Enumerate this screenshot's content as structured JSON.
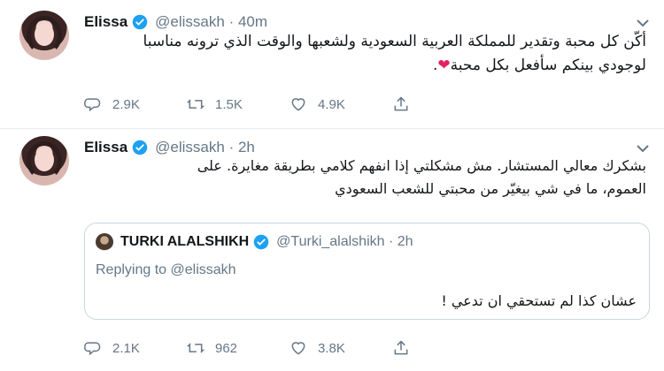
{
  "tweets": [
    {
      "name": "Elissa",
      "handle": "@elissakh",
      "time": "40m",
      "text_line1": "أكّن كل محبة وتقدير للمملكة العربية السعودية ولشعبها والوقت الذي ترونه مناسبا",
      "text_line2": "لوجودي بينكم سأفعل بكل محبة",
      "emoji": "❤",
      "replies": "2.9K",
      "retweets": "1.5K",
      "likes": "4.9K"
    },
    {
      "name": "Elissa",
      "handle": "@elissakh",
      "time": "2h",
      "text_line1": "بشكرك معالي المستشار. مش مشكلتي إذا انفهم كلامي بطريقة مغايرة. على",
      "text_line2": "العموم، ما في شي بيغيّر من محبتي للشعب السعودي",
      "replies": "2.1K",
      "retweets": "962",
      "likes": "3.8K",
      "quote": {
        "name": "TURKI ALALSHIKH",
        "handle": "@Turki_alalshikh",
        "time": "2h",
        "replying_to": "Replying to @elissakh",
        "text": "عشان كذا لم تستحقي ان تدعي !"
      }
    }
  ],
  "colors": {
    "accent": "#1da1f2",
    "muted": "#657786",
    "heart": "#e0245e"
  }
}
